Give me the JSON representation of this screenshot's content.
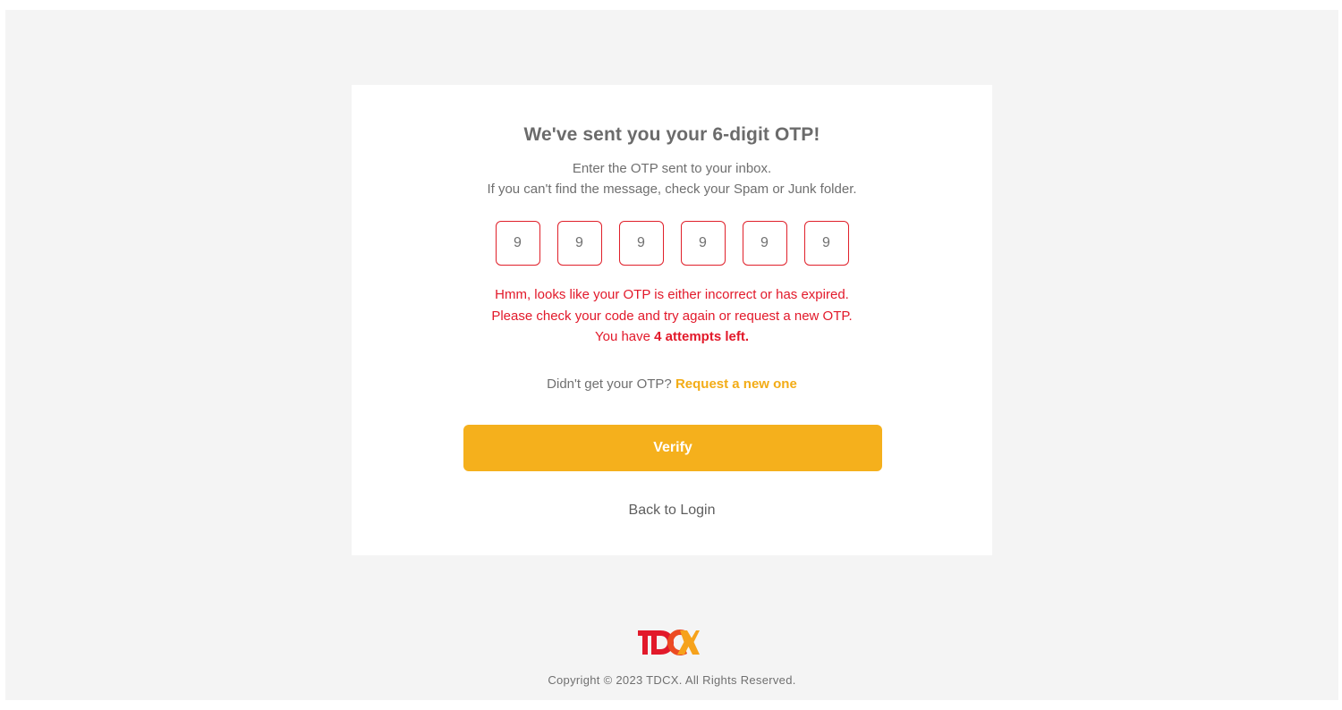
{
  "card": {
    "title": "We've sent you your 6-digit OTP!",
    "subtitle_line1": "Enter the OTP sent to your inbox.",
    "subtitle_line2": "If you can't find the message, check your Spam or Junk folder."
  },
  "otp": {
    "digits": [
      "9",
      "9",
      "9",
      "9",
      "9",
      "9"
    ]
  },
  "error": {
    "line1": "Hmm, looks like your OTP is either incorrect or has expired.",
    "line2": "Please check your code and try again or request a new OTP.",
    "line3_prefix": "You have ",
    "line3_bold": "4 attempts left."
  },
  "resend": {
    "prompt": "Didn't get your OTP?",
    "link": "Request a new one"
  },
  "verify_label": "Verify",
  "back_label": "Back to Login",
  "footer": {
    "logo_text": "TDCX",
    "copyright": "Copyright © 2023 TDCX. All Rights Reserved."
  },
  "colors": {
    "error": "#e2192a",
    "accent": "#f5b01c",
    "link": "#f3ac16",
    "logo_red": "#e2192a",
    "logo_orange": "#f6a21b"
  }
}
